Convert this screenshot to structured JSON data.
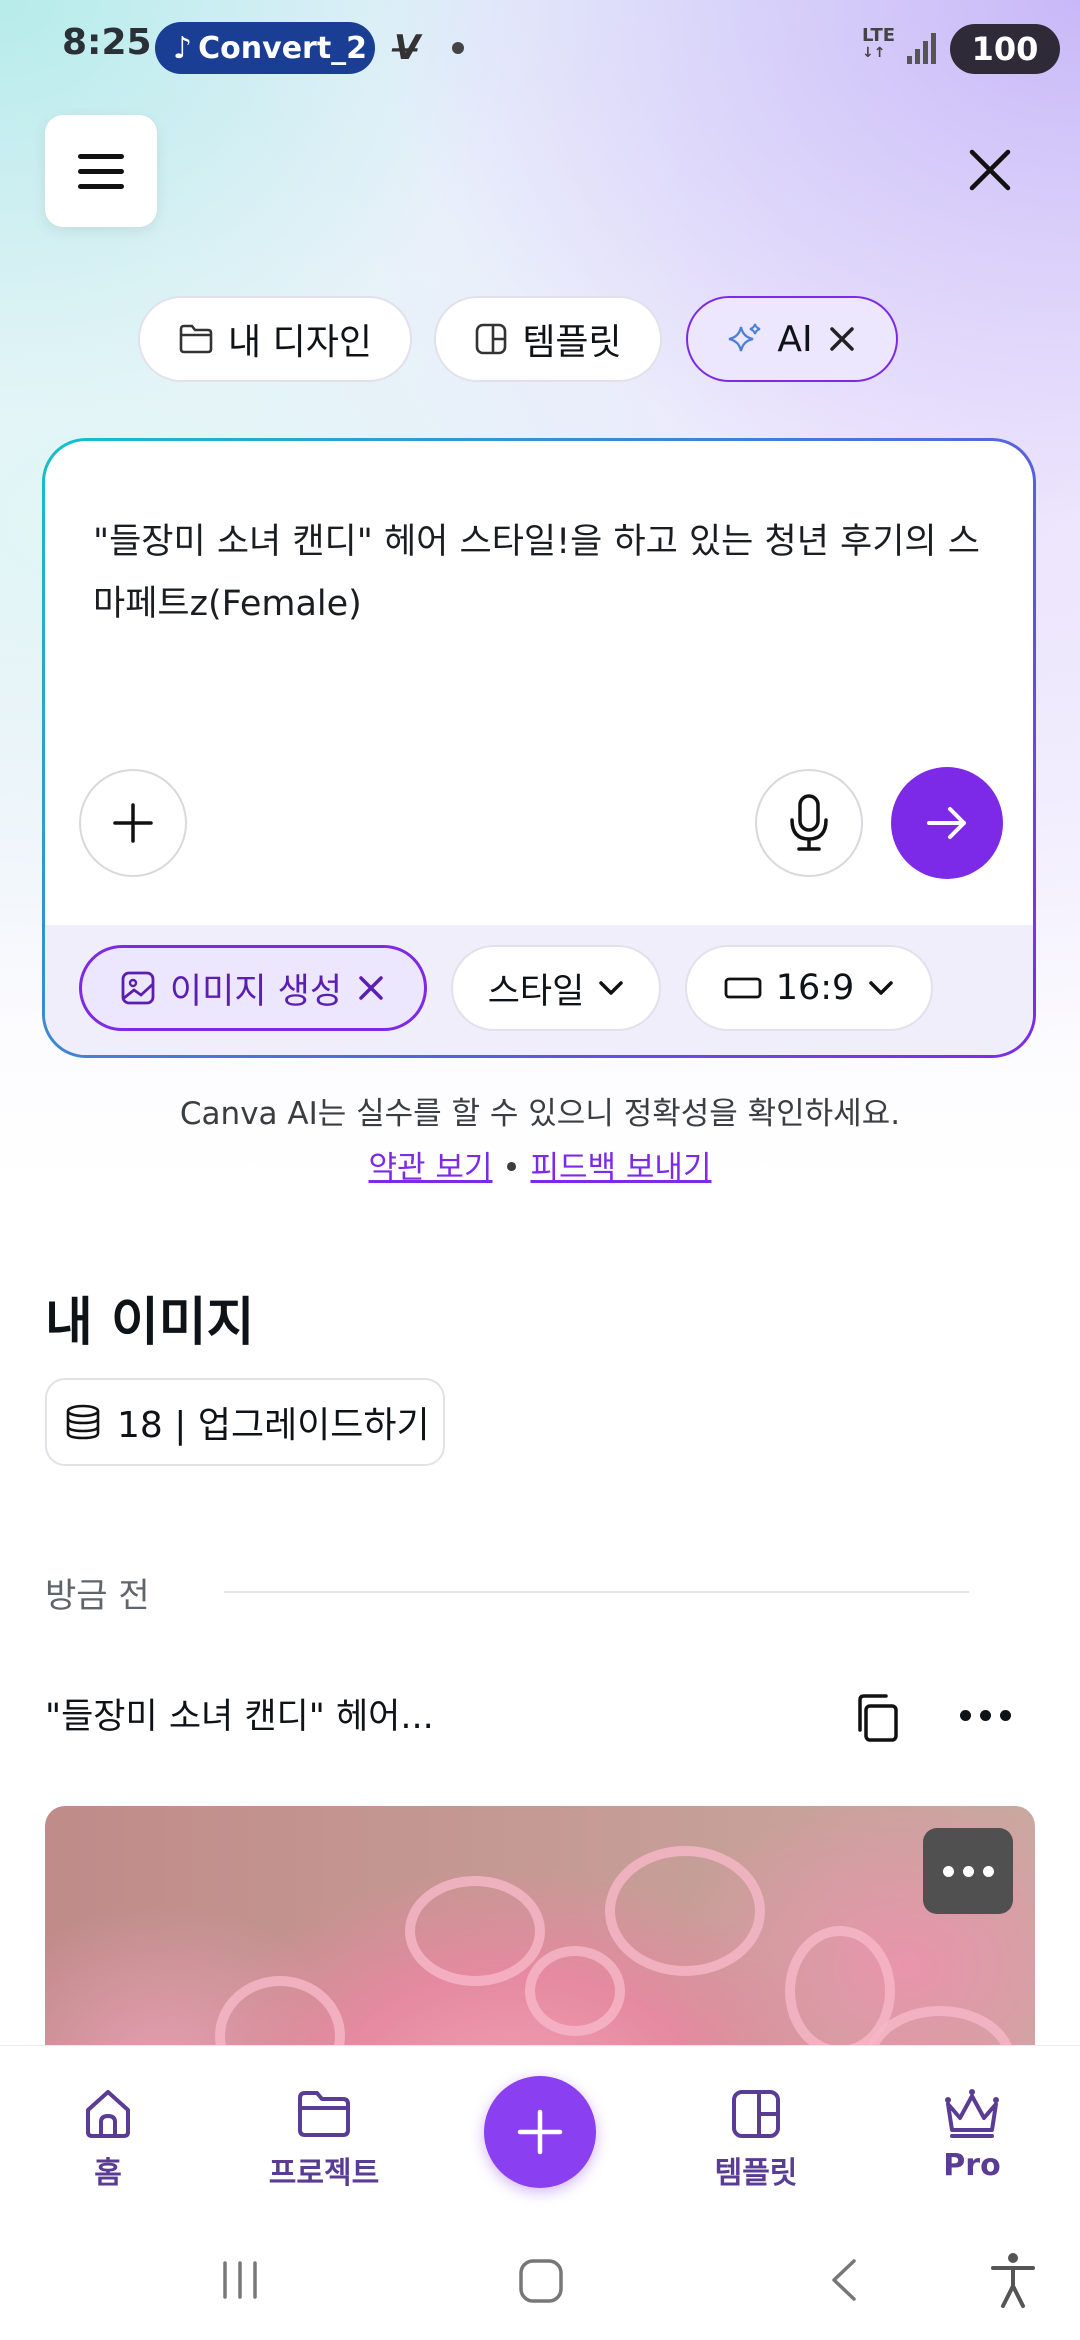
{
  "status_bar": {
    "time": "8:25",
    "media_title": "Convert_2",
    "network": "LTE",
    "battery": "100"
  },
  "tabs": [
    {
      "label": "내 디자인",
      "icon": "folder-icon"
    },
    {
      "label": "템플릿",
      "icon": "template-icon"
    },
    {
      "label": "AI",
      "icon": "sparkle-icon"
    }
  ],
  "prompt": {
    "text": "\"들장미 소녀 캔디\" 헤어 스타일!을 하고 있는 청년 후기의 스마페트z(Female)"
  },
  "options": {
    "mode": "이미지 생성",
    "style": "스타일",
    "ratio": "16:9"
  },
  "disclaimer": "Canva AI는 실수를 할 수 있으니 정확성을 확인하세요.",
  "links": {
    "terms": "약관 보기",
    "separator": "•",
    "feedback": "피드백 보내기"
  },
  "my_images": {
    "title": "내 이미지",
    "credits": "18 | 업그레이드하기"
  },
  "history": {
    "time_label": "방금 전",
    "item_title": "\"들장미 소녀 캔디\" 헤어..."
  },
  "bottom_nav": [
    {
      "label": "홈",
      "icon": "home-icon"
    },
    {
      "label": "프로젝트",
      "icon": "folder-icon"
    },
    {
      "label": "",
      "icon": "plus-icon"
    },
    {
      "label": "템플릿",
      "icon": "template-icon"
    },
    {
      "label": "Pro",
      "icon": "crown-icon"
    }
  ],
  "colors": {
    "accent": "#7d2ae8",
    "nav_text": "#5b3c94"
  }
}
